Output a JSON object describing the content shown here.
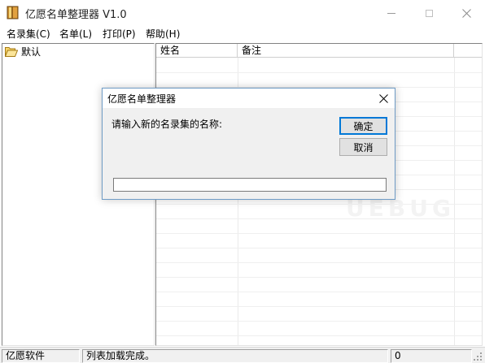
{
  "window": {
    "title": "亿愿名单整理器 V1.0"
  },
  "menu": {
    "items": [
      {
        "label": "名录集(C)"
      },
      {
        "label": "名单(L)"
      },
      {
        "label": "打印(P)"
      },
      {
        "label": "帮助(H)"
      }
    ]
  },
  "tree": {
    "items": [
      {
        "label": "默认",
        "icon": "open-folder-icon"
      }
    ]
  },
  "list": {
    "columns": [
      {
        "label": "姓名"
      },
      {
        "label": "备注"
      }
    ],
    "rows": []
  },
  "watermark": {
    "text": "UEBUG"
  },
  "status": {
    "company": "亿愿软件",
    "message": "列表加载完成。",
    "count": "0"
  },
  "dialog": {
    "title": "亿愿名单整理器",
    "prompt": "请输入新的名录集的名称:",
    "ok_label": "确定",
    "cancel_label": "取消",
    "input_value": "",
    "accent_color": "#0078d7"
  }
}
